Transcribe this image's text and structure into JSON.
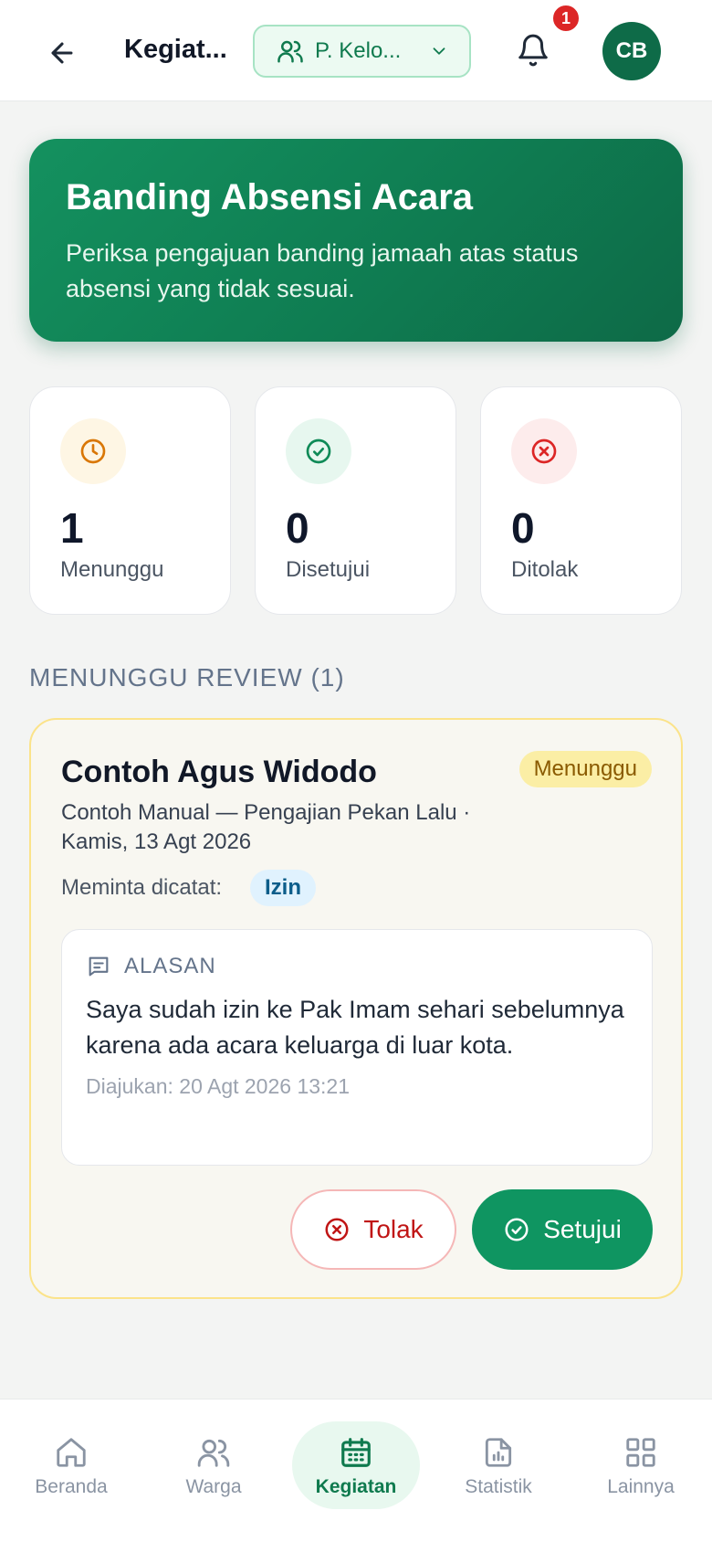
{
  "header": {
    "title": "Kegiat...",
    "context_label": "P. Kelo...",
    "notification_count": "1",
    "avatar_initials": "CB"
  },
  "hero": {
    "title": "Banding Absensi Acara",
    "subtitle": "Periksa pengajuan banding jamaah atas status absensi yang tidak sesuai."
  },
  "stats": [
    {
      "value": "1",
      "label": "Menunggu",
      "color": "#d97706",
      "bg": "#fef6e4"
    },
    {
      "value": "0",
      "label": "Disetujui",
      "color": "#0f8a57",
      "bg": "#e7f7ef"
    },
    {
      "value": "0",
      "label": "Ditolak",
      "color": "#dc2626",
      "bg": "#fdecec"
    }
  ],
  "section": {
    "title": "MENUNGGU REVIEW (1)"
  },
  "review": {
    "name": "Contoh Agus Widodo",
    "status": "Menunggu",
    "event": "Contoh Manual — Pengajian Pekan Lalu · Kamis, 13 Agt 2026",
    "requested_label": "Meminta dicatat:",
    "requested_value": "Izin",
    "reason_title": "ALASAN",
    "reason_text": "Saya sudah izin ke Pak Imam sehari sebelumnya karena ada acara keluarga di luar kota.",
    "submitted": "Diajukan: 20 Agt 2026 13:21",
    "reject_label": "Tolak",
    "approve_label": "Setujui"
  },
  "nav": [
    {
      "label": "Beranda",
      "icon": "home-icon"
    },
    {
      "label": "Warga",
      "icon": "users-icon"
    },
    {
      "label": "Kegiatan",
      "icon": "calendar-icon",
      "active": true
    },
    {
      "label": "Statistik",
      "icon": "chart-file-icon"
    },
    {
      "label": "Lainnya",
      "icon": "grid-icon"
    }
  ],
  "colors": {
    "brand": "#0f8a57",
    "accent_dark": "#0e6b48",
    "warning": "#d97706",
    "danger": "#dc2626"
  }
}
